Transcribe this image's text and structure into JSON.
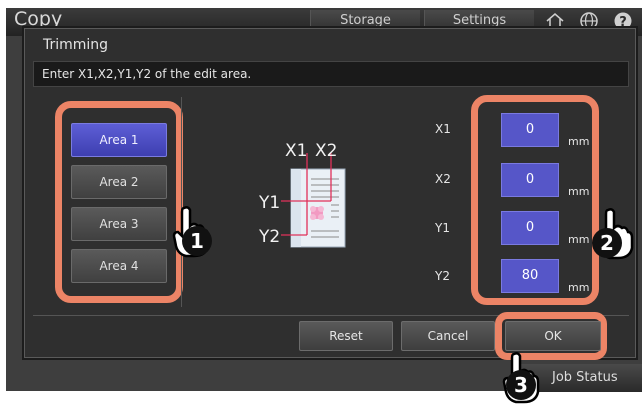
{
  "app": {
    "title": "Copy",
    "tabs": [
      "Storage",
      "Settings"
    ],
    "job_status": "Job Status"
  },
  "dialog": {
    "title": "Trimming",
    "instruction": "Enter X1,X2,Y1,Y2 of the edit area.",
    "areas": [
      "Area 1",
      "Area 2",
      "Area 3",
      "Area 4"
    ],
    "selected_area": "Area 1",
    "diagram_labels": {
      "x1": "X1",
      "x2": "X2",
      "y1": "Y1",
      "y2": "Y2"
    },
    "coords": [
      {
        "label": "X1",
        "value": "0",
        "unit": "mm"
      },
      {
        "label": "X2",
        "value": "0",
        "unit": "mm"
      },
      {
        "label": "Y1",
        "value": "0",
        "unit": "mm"
      },
      {
        "label": "Y2",
        "value": "80",
        "unit": "mm"
      }
    ],
    "buttons": {
      "reset": "Reset",
      "cancel": "Cancel",
      "ok": "OK"
    }
  },
  "callouts": [
    "1",
    "2",
    "3"
  ],
  "colors": {
    "highlight": "#ec8466",
    "selected": "#5656c8"
  }
}
